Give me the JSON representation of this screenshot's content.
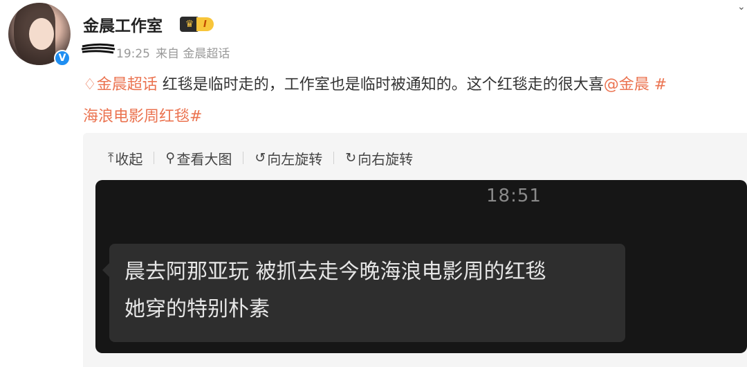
{
  "user": {
    "name": "金晨工作室",
    "vip_level": "I",
    "verify_mark": "V"
  },
  "meta": {
    "time": "19:25",
    "source": "来自 金晨超话"
  },
  "post": {
    "topic_tag": "金晨超话",
    "text_main": " 红毯是临时走的，工作室也是临时被通知的。这个红毯走的很大喜",
    "mention": "@金晨",
    "hashtag_part1": " #",
    "hashtag_part2": "海浪电影周红毯#"
  },
  "toolbar": {
    "collapse": "收起",
    "view_large": "查看大图",
    "rotate_left": "向左旋转",
    "rotate_right": "向右旋转"
  },
  "photo": {
    "time": "18:51",
    "message": "晨去阿那亚玩  被抓去走今晚海浪电影周的红毯\n她穿的特别朴素"
  },
  "colors": {
    "link": "#eb7350",
    "vip_gold": "#f8c53a",
    "verify_blue": "#1f8ef1",
    "photo_bg": "#161616",
    "bubble_bg": "#2e2e2e"
  }
}
